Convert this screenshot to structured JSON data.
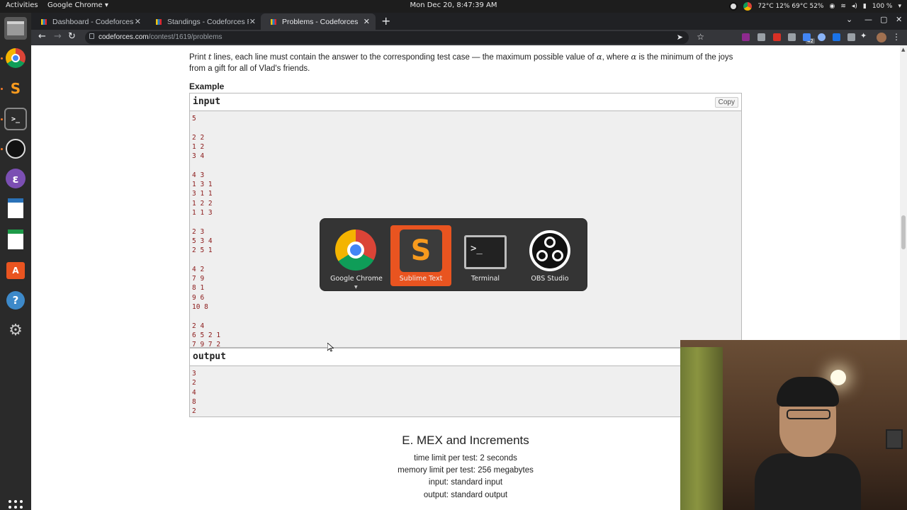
{
  "topbar": {
    "activities": "Activities",
    "app_menu": "Google Chrome ▾",
    "clock": "Mon Dec 20,  8:47:39 AM",
    "sensors": "72°C 12% 69°C 52%",
    "battery": "100 %"
  },
  "tabs": [
    {
      "label": "Dashboard - Codeforces R",
      "active": false
    },
    {
      "label": "Standings - Codeforces R",
      "active": false
    },
    {
      "label": "Problems - Codeforces",
      "active": true
    }
  ],
  "toolbar": {
    "url_host": "codeforces.com",
    "url_path": "/contest/1619/problems",
    "extension_badge": "42"
  },
  "dock": {
    "items": [
      "google-chrome",
      "sublime-text",
      "terminal",
      "obs-studio",
      "emacs",
      "libreoffice-writer",
      "libreoffice-calc",
      "ubuntu-software",
      "help",
      "settings"
    ]
  },
  "problem_d": {
    "output_desc_1": "Print ",
    "output_desc_var_t": "t",
    "output_desc_2": " lines, each line must contain the answer to the corresponding test case — the maximum possible value of ",
    "output_desc_alpha": "α",
    "output_desc_3": ", where ",
    "output_desc_alpha2": "α",
    "output_desc_4": " is the minimum of the joys from a gift for all of Vlad's friends.",
    "example_title": "Example",
    "input_label": "input",
    "output_label": "output",
    "copy_label": "Copy",
    "input_lines": [
      "5",
      "",
      "2 2",
      "1 2",
      "3 4",
      "",
      "4 3",
      "1 3 1",
      "3 1 1",
      "1 2 2",
      "1 1 3",
      "",
      "2 3",
      "5 3 4",
      "2 5 1",
      "",
      "4 2",
      "7 9",
      "8 1",
      "9 6",
      "10 8",
      "",
      "2 4",
      "6 5 2 1",
      "7 9 7 2"
    ],
    "output_lines": [
      "3",
      "2",
      "4",
      "8",
      "2"
    ]
  },
  "problem_e": {
    "title": "E. MEX and Increments",
    "time_limit": "time limit per test: 2 seconds",
    "memory_limit": "memory limit per test: 256 megabytes",
    "input": "input: standard input",
    "output": "output: standard output"
  },
  "switcher": {
    "items": [
      {
        "label": "Google Chrome",
        "selected": false
      },
      {
        "label": "Sublime Text",
        "selected": true
      },
      {
        "label": "Terminal",
        "selected": false
      },
      {
        "label": "OBS Studio",
        "selected": false
      }
    ]
  },
  "colors": {
    "ubuntu_orange": "#e95420",
    "example_text": "#8b1a1a",
    "chrome_dark": "#35363a"
  }
}
